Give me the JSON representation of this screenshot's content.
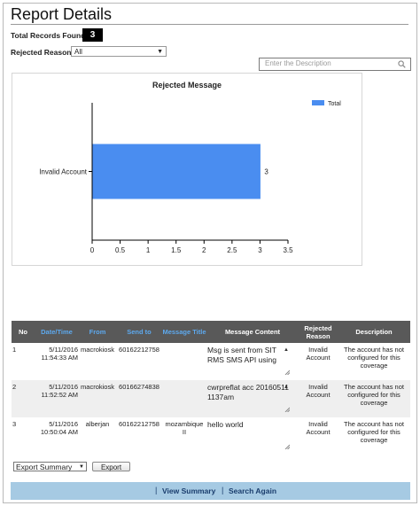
{
  "page": {
    "title": "Report Details",
    "total_label": "Total Records Found:",
    "total_count": "3",
    "rejected_label": "Rejected Reason:",
    "rejected_value": "All",
    "search_placeholder": "Enter the Description"
  },
  "chart_data": {
    "type": "bar",
    "orientation": "horizontal",
    "title": "Rejected Message",
    "categories": [
      "Invalid Account"
    ],
    "series": [
      {
        "name": "Total",
        "values": [
          3
        ],
        "color": "#4a8df0"
      }
    ],
    "data_labels": [
      "3"
    ],
    "xlim": [
      0,
      3.5
    ],
    "x_ticks": [
      "0",
      "0.5",
      "1",
      "1.5",
      "2",
      "2.5",
      "3",
      "3.5"
    ],
    "legend": "top-right",
    "grid": false
  },
  "table": {
    "headers": [
      "No",
      "Date/Time",
      "From",
      "Send to",
      "Message Title",
      "Message Content",
      "Rejected Reason",
      "Description"
    ],
    "rows": [
      {
        "no": "1",
        "date": "5/11/2016",
        "time": "11:54:33 AM",
        "from": "macrokiosk",
        "send_to": "60162212758",
        "title": "",
        "content": "Msg is sent from SIT RMS SMS API using",
        "reason": "Invalid Account",
        "description": "The account has not configured for this coverage"
      },
      {
        "no": "2",
        "date": "5/11/2016",
        "time": "11:52:52 AM",
        "from": "macrokiosk",
        "send_to": "60166274838",
        "title": "",
        "content": "cwrpreflat acc 20160511 1137am",
        "reason": "Invalid Account",
        "description": "The account has not configured for this coverage"
      },
      {
        "no": "3",
        "date": "5/11/2016",
        "time": "10:50:04 AM",
        "from": "alberjan",
        "send_to": "60162212758",
        "title": "mozambique II",
        "content": "hello world",
        "reason": "Invalid Account",
        "description": "The account has not configured for this coverage"
      }
    ]
  },
  "actions": {
    "export_summary": "Export Summary",
    "export": "Export",
    "view_summary": "View Summary",
    "search_again": "Search Again",
    "separator": "|"
  },
  "colors": {
    "bar": "#4a8df0",
    "header_bg": "#595959",
    "link": "#5da9ee",
    "footer_bg": "#a6cae3"
  }
}
